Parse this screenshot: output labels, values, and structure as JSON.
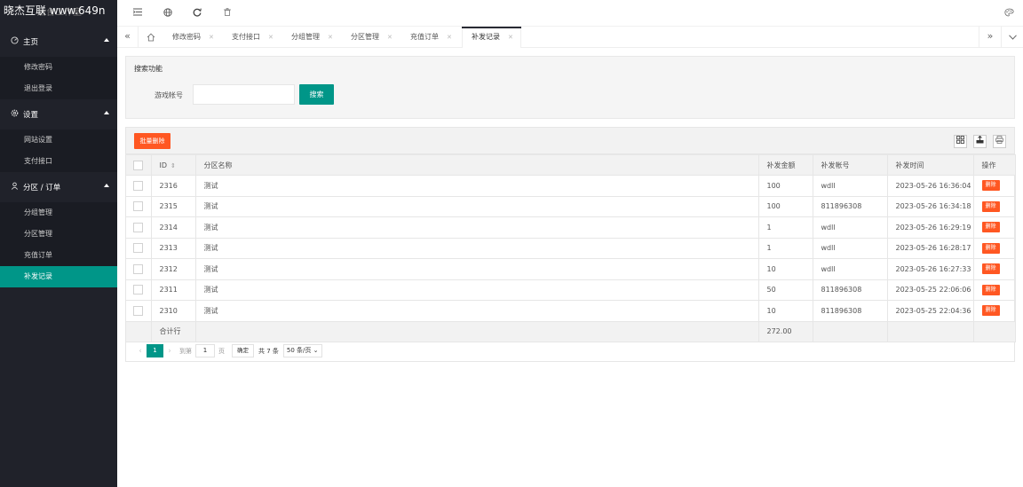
{
  "app": {
    "logo_text": "晓杰互联 www.649n",
    "logo_underlay": "后台工作室"
  },
  "sidebar": {
    "groups": [
      {
        "title": "主页",
        "icon": "dashboard-icon",
        "items": [
          "修改密码",
          "退出登录"
        ]
      },
      {
        "title": "设置",
        "icon": "gear-icon",
        "items": [
          "网站设置",
          "支付接口"
        ]
      },
      {
        "title": "分区 / 订单",
        "icon": "user-icon",
        "items": [
          "分组管理",
          "分区管理",
          "充值订单",
          "补发记录"
        ]
      }
    ],
    "active_item": "补发记录"
  },
  "topbar": {
    "icons": [
      "menu-toggle-icon",
      "globe-icon",
      "refresh-icon",
      "clear-cache-icon",
      "theme-icon"
    ]
  },
  "tabs": [
    {
      "label": "修改密码"
    },
    {
      "label": "支付接口"
    },
    {
      "label": "分组管理"
    },
    {
      "label": "分区管理"
    },
    {
      "label": "充值订单"
    },
    {
      "label": "补发记录",
      "active": true
    }
  ],
  "search": {
    "title": "搜索功能",
    "label": "游戏帐号",
    "value": "",
    "button": "搜索"
  },
  "table": {
    "batch_delete": "批量删除",
    "columns": [
      "ID",
      "分区名称",
      "补发金额",
      "补发帐号",
      "补发时间",
      "操作"
    ],
    "action_label": "删除",
    "rows": [
      {
        "id": "2316",
        "zone": "测试",
        "amount": "100",
        "account": "wdll",
        "time": "2023-05-26 16:36:04"
      },
      {
        "id": "2315",
        "zone": "测试",
        "amount": "100",
        "account": "811896308",
        "time": "2023-05-26 16:34:18"
      },
      {
        "id": "2314",
        "zone": "测试",
        "amount": "1",
        "account": "wdll",
        "time": "2023-05-26 16:29:19"
      },
      {
        "id": "2313",
        "zone": "测试",
        "amount": "1",
        "account": "wdll",
        "time": "2023-05-26 16:28:17"
      },
      {
        "id": "2312",
        "zone": "测试",
        "amount": "10",
        "account": "wdll",
        "time": "2023-05-26 16:27:33"
      },
      {
        "id": "2311",
        "zone": "测试",
        "amount": "50",
        "account": "811896308",
        "time": "2023-05-25 22:06:06"
      },
      {
        "id": "2310",
        "zone": "测试",
        "amount": "10",
        "account": "811896308",
        "time": "2023-05-25 22:04:36"
      }
    ],
    "total_label": "合计行",
    "total_amount": "272.00"
  },
  "pager": {
    "prev": "‹",
    "current": "1",
    "next": "›",
    "goto_label": "到第",
    "goto_value": "1",
    "page_unit": "页",
    "confirm": "确定",
    "total": "共 7 条",
    "page_size": "50 条/页"
  }
}
